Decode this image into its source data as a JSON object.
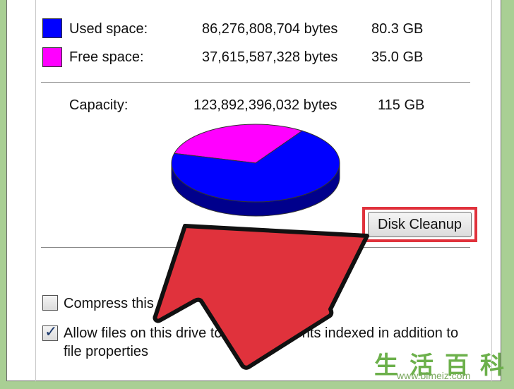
{
  "disk": {
    "used": {
      "label": "Used space:",
      "bytes": "86,276,808,704 bytes",
      "size": "80.3 GB",
      "color": "#0000ff"
    },
    "free": {
      "label": "Free space:",
      "bytes": "37,615,587,328 bytes",
      "size": "35.0 GB",
      "color": "#ff00ff"
    },
    "capacity": {
      "label": "Capacity:",
      "bytes": "123,892,396,032 bytes",
      "size": "115 GB"
    }
  },
  "chart_data": {
    "type": "pie",
    "categories": [
      "Used space",
      "Free space"
    ],
    "values": [
      86276808704,
      37615587328
    ],
    "colors": [
      "#0000ff",
      "#ff00ff"
    ]
  },
  "buttons": {
    "disk_cleanup": "Disk Cleanup"
  },
  "options": {
    "compress": {
      "label": "Compress this",
      "checked": false
    },
    "index": {
      "label_line1": "Allow files on this drive to ha",
      "label_line1b": "ntents indexed in addition to",
      "label_line2": "file properties",
      "checked": true
    }
  },
  "annotation": {
    "arrow_color": "#e0323c",
    "highlight_color": "#e0323c"
  },
  "watermark": {
    "glyphs": [
      "生",
      "活",
      "百",
      "科"
    ],
    "url": "www.bimeiz.com"
  }
}
